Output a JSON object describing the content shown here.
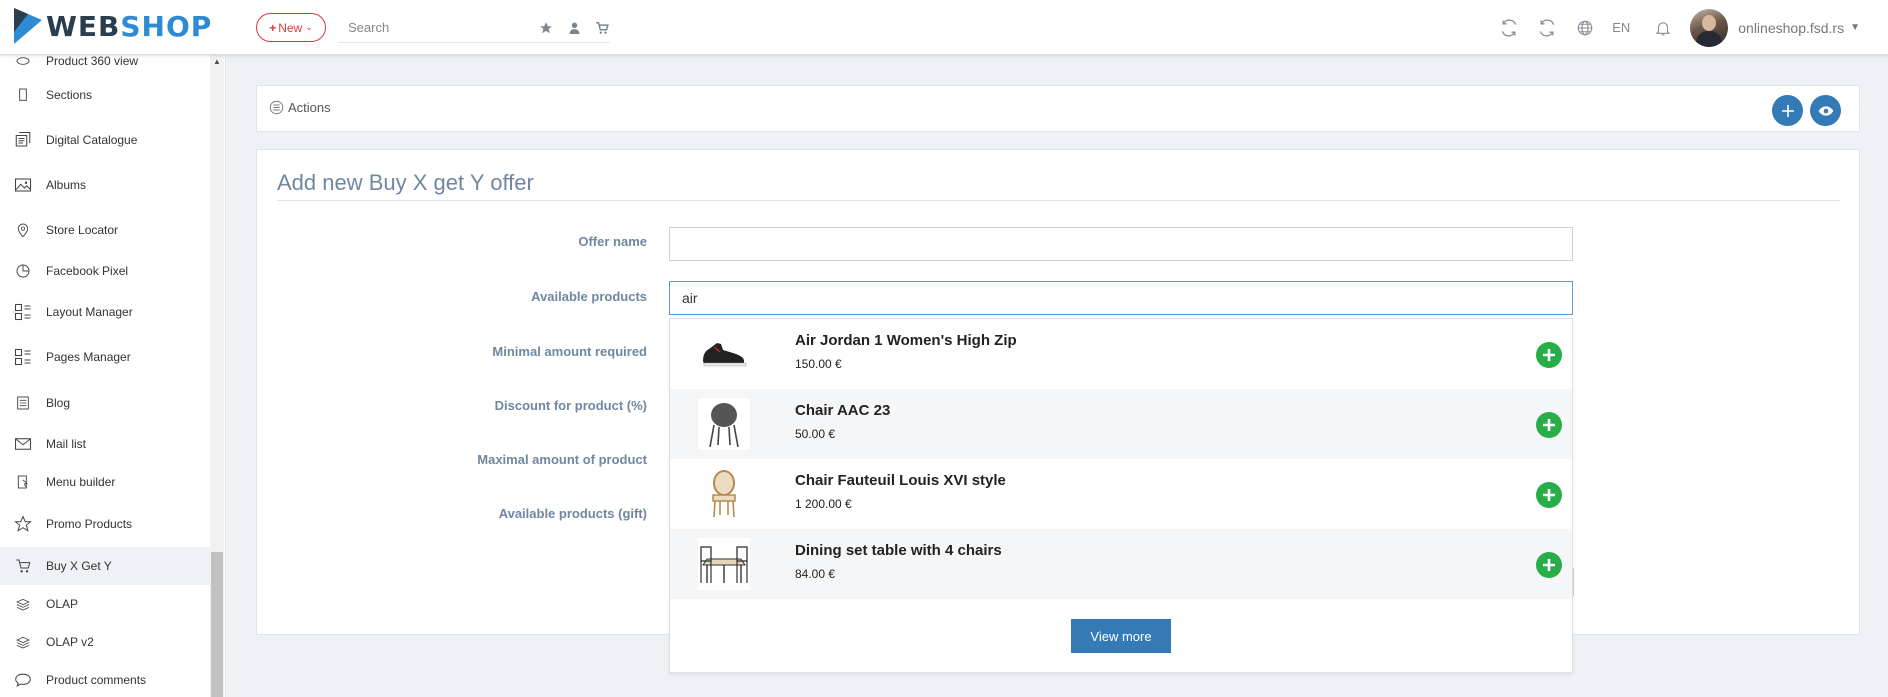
{
  "header": {
    "logo": {
      "part1": "WEB",
      "part2": "SHOP"
    },
    "new_button": {
      "icon": "plus-icon",
      "label": "New"
    },
    "search": {
      "placeholder": "Search"
    },
    "quick_icons": [
      "star-icon",
      "user-icon",
      "cart-icon"
    ],
    "right_icons": [
      "refresh-icon",
      "sync-icon",
      "globe-icon"
    ],
    "language": "EN",
    "notifications_icon": "bell-icon",
    "site_name": "onlineshop.fsd.rs"
  },
  "sidebar": {
    "items": [
      {
        "label": "Product 360 view",
        "icon": "rotate-icon"
      },
      {
        "label": "Sections",
        "icon": "page-icon"
      },
      {
        "label": "Digital Catalogue",
        "icon": "catalogue-icon"
      },
      {
        "label": "Albums",
        "icon": "image-icon"
      },
      {
        "label": "Store Locator",
        "icon": "map-pin-icon"
      },
      {
        "label": "Facebook Pixel",
        "icon": "pie-chart-icon"
      },
      {
        "label": "Layout Manager",
        "icon": "layout-icon"
      },
      {
        "label": "Pages Manager",
        "icon": "layout-icon"
      },
      {
        "label": "Blog",
        "icon": "blog-icon"
      },
      {
        "label": "Mail list",
        "icon": "envelope-icon"
      },
      {
        "label": "Menu builder",
        "icon": "menu-icon"
      },
      {
        "label": "Promo Products",
        "icon": "star-icon"
      },
      {
        "label": "Buy X Get Y",
        "icon": "cart-icon",
        "active": true
      },
      {
        "label": "OLAP",
        "icon": "layers-icon"
      },
      {
        "label": "OLAP v2",
        "icon": "layers-icon"
      },
      {
        "label": "Product comments",
        "icon": "comment-icon"
      }
    ]
  },
  "actions": {
    "label": "Actions",
    "icon": "list-icon",
    "buttons": [
      {
        "name": "add-button",
        "icon": "plus-icon"
      },
      {
        "name": "preview-button",
        "icon": "eye-icon"
      }
    ]
  },
  "form": {
    "title": "Add new Buy X get Y offer",
    "fields": {
      "offer_name": {
        "label": "Offer name",
        "value": ""
      },
      "available_products": {
        "label": "Available products",
        "value": "air"
      },
      "minimal_amount": {
        "label": "Minimal amount required"
      },
      "discount": {
        "label": "Discount for product (%)"
      },
      "maximal_amount": {
        "label": "Maximal amount of product"
      },
      "gift_products": {
        "label": "Available products (gift)"
      }
    }
  },
  "dropdown": {
    "results": [
      {
        "name": "Air Jordan 1 Women's High Zip",
        "price": "150.00 €",
        "thumb": "sneaker-image"
      },
      {
        "name": "Chair AAC 23",
        "price": "50.00 €",
        "thumb": "chair-image"
      },
      {
        "name": "Chair Fauteuil Louis XVI style",
        "price": "1 200.00 €",
        "thumb": "armchair-image"
      },
      {
        "name": "Dining set table with 4 chairs",
        "price": "84.00 €",
        "thumb": "dining-set-image"
      }
    ],
    "view_more_label": "View more"
  },
  "colors": {
    "brand_dark": "#2b3e4f",
    "brand_blue": "#2d8bd6",
    "accent_red": "#e0393e",
    "primary_blue": "#337ab7",
    "add_green": "#27ae48",
    "label_slate": "#6f87a0"
  }
}
